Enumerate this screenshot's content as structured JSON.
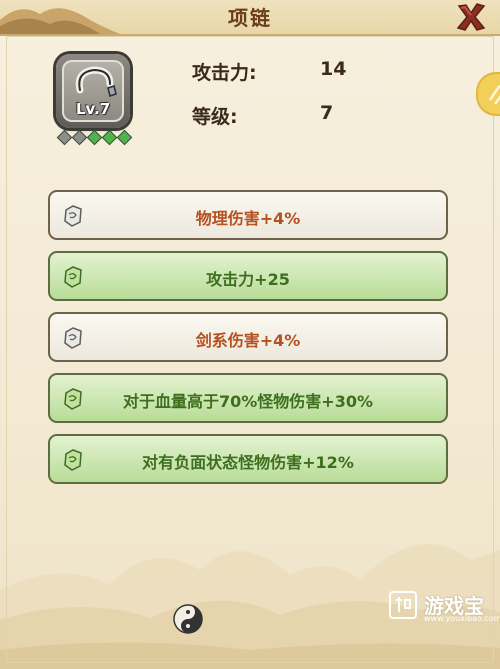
{
  "window": {
    "title": "项链",
    "close_icon": "close-x-icon"
  },
  "item": {
    "icon_name": "necklace-icon",
    "level_badge": "Lv.7",
    "gems_total": 5,
    "gems_active": 3
  },
  "stats": [
    {
      "label": "攻击力:",
      "value": "14"
    },
    {
      "label": "等级:",
      "value": "7"
    }
  ],
  "attributes": [
    {
      "text": "物理伤害+4%",
      "tier": "white",
      "icon": "crystal-gray-icon"
    },
    {
      "text": "攻击力+25",
      "tier": "green",
      "icon": "crystal-green-icon"
    },
    {
      "text": "剑系伤害+4%",
      "tier": "white",
      "icon": "crystal-gray-icon"
    },
    {
      "text": "对于血量高于70%怪物伤害+30%",
      "tier": "green",
      "icon": "crystal-green-icon"
    },
    {
      "text": "对有负面状态怪物伤害+12%",
      "tier": "green",
      "icon": "crystal-green-icon"
    }
  ],
  "watermark": {
    "text": "游戏宝",
    "sub": "www.youxibao.com"
  },
  "colors": {
    "title": "#6b3e1a",
    "white_row_text": "#b5501f",
    "green_row_text": "#3e6f1e",
    "gem_active": "#4fb54a",
    "gem_inactive": "#8d8f89"
  }
}
